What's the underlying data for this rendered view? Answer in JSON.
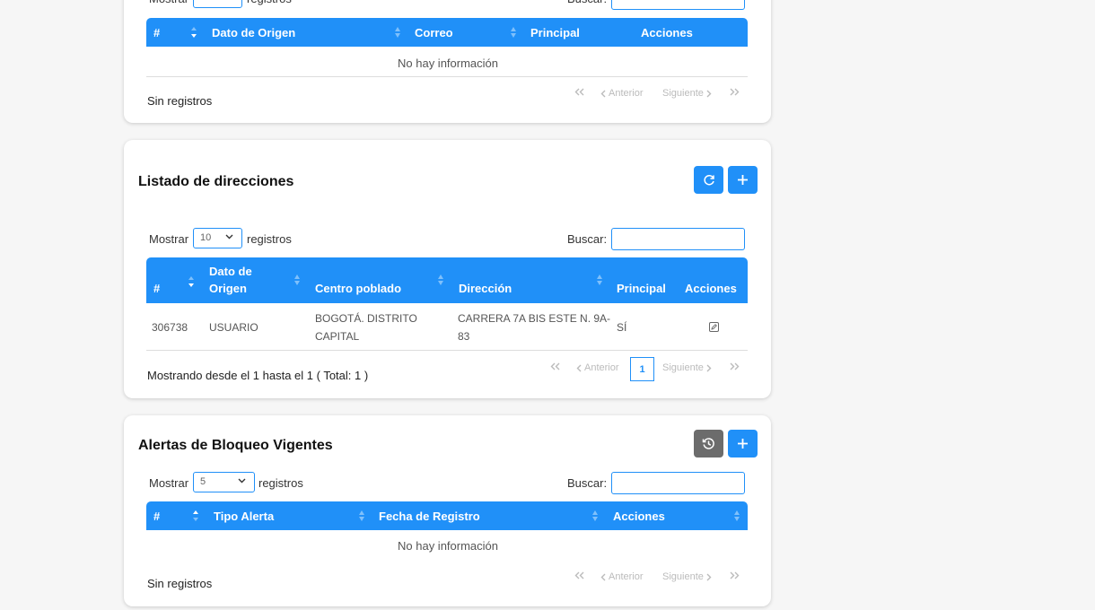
{
  "common": {
    "show_label": "Mostrar",
    "records_label": "registros",
    "search_label": "Buscar:",
    "empty_text": "No hay información",
    "no_records": "Sin registros",
    "prev": "Anterior",
    "next": "Siguiente"
  },
  "emails": {
    "page_size": "10",
    "columns": [
      "#",
      "Dato de Origen",
      "Correo",
      "Principal",
      "Acciones"
    ]
  },
  "addresses": {
    "title": "Listado de direcciones",
    "page_size": "10",
    "columns": [
      "#",
      "Dato de",
      "Origen",
      "Centro poblado",
      "Dirección",
      "Principal",
      "Acciones"
    ],
    "rows": [
      {
        "id": "306738",
        "origin": "USUARIO",
        "town_1": "BOGOTÁ. DISTRITO",
        "town_2": "CAPITAL",
        "address_1": "CARRERA 7A BIS ESTE N. 9A-",
        "address_2": "83",
        "principal": "SÍ"
      }
    ],
    "info": "Mostrando desde el 1 hasta el 1 ( Total: 1 )",
    "current_page": "1"
  },
  "alerts": {
    "title": "Alertas de Bloqueo Vigentes",
    "page_size": "5",
    "columns": [
      "#",
      "Tipo Alerta",
      "Fecha de Registro",
      "Acciones"
    ]
  },
  "colors": {
    "accent": "#2090f8",
    "gray_button": "#6c6c6c"
  }
}
